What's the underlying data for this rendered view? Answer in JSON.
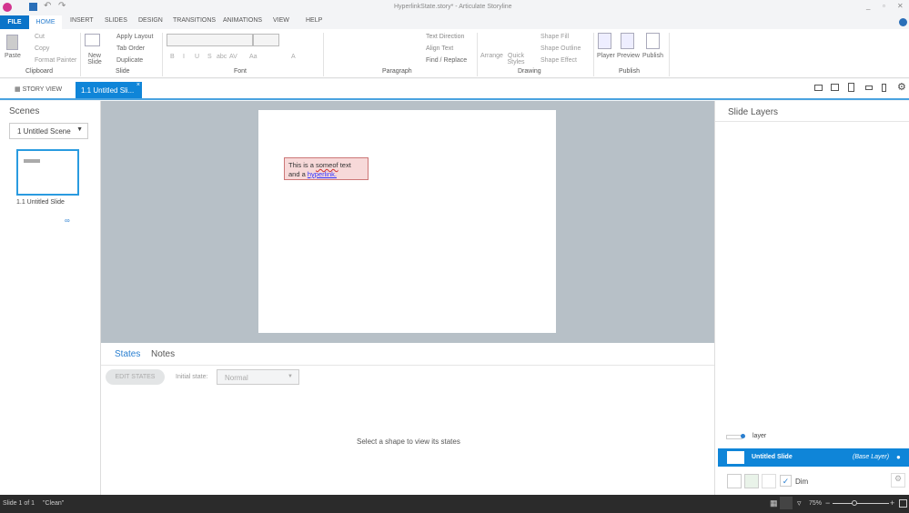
{
  "title": "HyperlinkState.story* - Articulate Storyline",
  "ribbon_tabs": [
    "FILE",
    "HOME",
    "INSERT",
    "SLIDES",
    "DESIGN",
    "TRANSITIONS",
    "ANIMATIONS",
    "VIEW",
    "HELP"
  ],
  "clipboard": {
    "paste": "Paste",
    "cut": "Cut",
    "copy": "Copy",
    "format_painter": "Format Painter",
    "group": "Clipboard"
  },
  "slide_grp": {
    "new_slide": "New Slide",
    "apply_layout": "Apply Layout",
    "tab_order": "Tab Order",
    "duplicate": "Duplicate",
    "group": "Slide"
  },
  "font": {
    "group": "Font",
    "bold": "B",
    "italic": "I",
    "underline": "U",
    "strike": "S",
    "abc": "abc",
    "av": "AV",
    "aa": "Aa",
    "a": "A"
  },
  "paragraph": {
    "text_direction": "Text Direction",
    "align_text": "Align Text",
    "find_replace": "Find / Replace",
    "group": "Paragraph"
  },
  "drawing": {
    "arrange": "Arrange",
    "quick_styles": "Quick Styles",
    "shape_fill": "Shape Fill",
    "shape_outline": "Shape Outline",
    "shape_effect": "Shape Effect",
    "group": "Drawing"
  },
  "publish": {
    "player": "Player",
    "preview": "Preview",
    "publish": "Publish",
    "group": "Publish"
  },
  "doc_tabs": {
    "story_view": "STORY VIEW",
    "slide_tab": "1.1 Untitled Sli..."
  },
  "scenes": {
    "title": "Scenes",
    "dropdown": "1 Untitled Scene",
    "thumb_label": "1.1 Untitled Slide"
  },
  "slide": {
    "line1_a": "This is a ",
    "line1_b": "someof",
    "line1_c": " text",
    "line2_a": "and a ",
    "link": "hyperlink."
  },
  "states": {
    "tab_states": "States",
    "tab_notes": "Notes",
    "edit_states": "EDIT STATES",
    "initial_label": "Initial state:",
    "initial_value": "Normal",
    "empty": "Select a shape to view its states"
  },
  "layers": {
    "title": "Slide Layers",
    "layer": "layer",
    "base_name": "Untitled Slide",
    "base_tag": "(Base Layer)",
    "dim": "Dim"
  },
  "status": {
    "slide": "Slide 1 of 1",
    "clean": "\"Clean\"",
    "zoom": "75%"
  },
  "colors": {
    "accent": "#0a74c9",
    "selected": "#0f85d8"
  }
}
